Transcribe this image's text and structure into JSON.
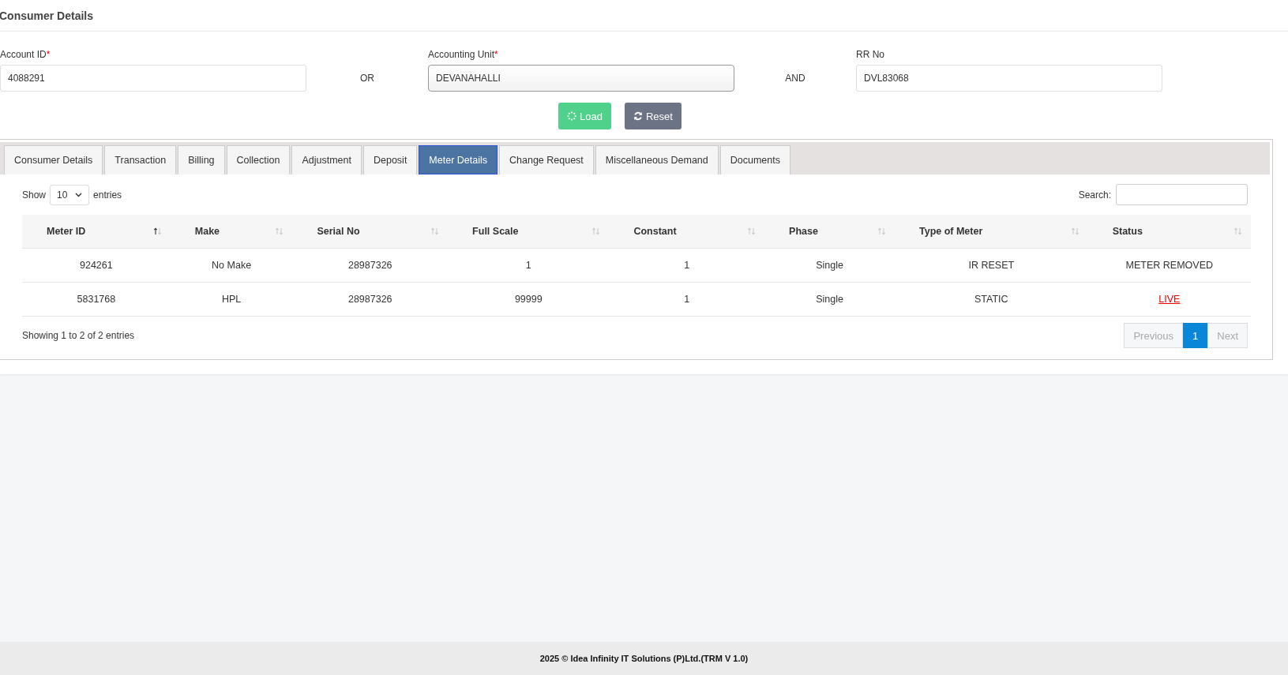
{
  "page_title": "Consumer Details",
  "fields": [
    {
      "label": "Account ID",
      "required_mark": "*",
      "value": "4088291",
      "kind": "input"
    },
    {
      "kind": "joiner",
      "text": "OR"
    },
    {
      "label": "Accounting Unit",
      "required_mark": "*",
      "value": "DEVANAHALLI",
      "kind": "select"
    },
    {
      "kind": "joiner",
      "text": "AND"
    },
    {
      "label": "RR No",
      "value": "DVL83068",
      "kind": "input"
    }
  ],
  "buttons": [
    {
      "label": "Load",
      "kind": "load"
    },
    {
      "label": "Reset",
      "kind": "reset"
    }
  ],
  "tabs": [
    {
      "label": "Consumer Details",
      "selected": false
    },
    {
      "label": "Transaction",
      "selected": false
    },
    {
      "label": "Billing",
      "selected": false
    },
    {
      "label": "Collection",
      "selected": false
    },
    {
      "label": "Adjustment",
      "selected": false
    },
    {
      "label": "Deposit",
      "selected": false
    },
    {
      "label": "Meter Details",
      "selected": true
    },
    {
      "label": "Change Request",
      "selected": false
    },
    {
      "label": "Miscellaneous Demand",
      "selected": false
    },
    {
      "label": "Documents",
      "selected": false
    }
  ],
  "table": {
    "show_label": "Show",
    "page_size": "10",
    "entries_label": "entries",
    "search_label": "Search:",
    "columns": [
      {
        "label": "Meter ID",
        "sorted": true
      },
      {
        "label": "Make",
        "sorted": false
      },
      {
        "label": "Serial No",
        "sorted": false
      },
      {
        "label": "Full Scale",
        "sorted": false
      },
      {
        "label": "Constant",
        "sorted": false
      },
      {
        "label": "Phase",
        "sorted": false
      },
      {
        "label": "Type of Meter",
        "sorted": false
      },
      {
        "label": "Status",
        "sorted": false
      }
    ],
    "rows": [
      {
        "cells": [
          "924261",
          "No Make",
          "28987326",
          "1",
          "1",
          "Single",
          "IR RESET",
          "METER REMOVED"
        ],
        "status_link": false
      },
      {
        "cells": [
          "5831768",
          "HPL",
          "28987326",
          "99999",
          "1",
          "Single",
          "STATIC",
          "LIVE"
        ],
        "status_link": true
      }
    ],
    "info": "Showing 1 to 2 of 2 entries",
    "pagination": [
      {
        "label": "Previous",
        "disabled": true,
        "selected": false
      },
      {
        "label": "1",
        "disabled": false,
        "selected": true
      },
      {
        "label": "Next",
        "disabled": true,
        "selected": false
      }
    ]
  },
  "footer": "2025 © Idea Infinity IT Solutions (P)Ltd.(TRM V 1.0)"
}
